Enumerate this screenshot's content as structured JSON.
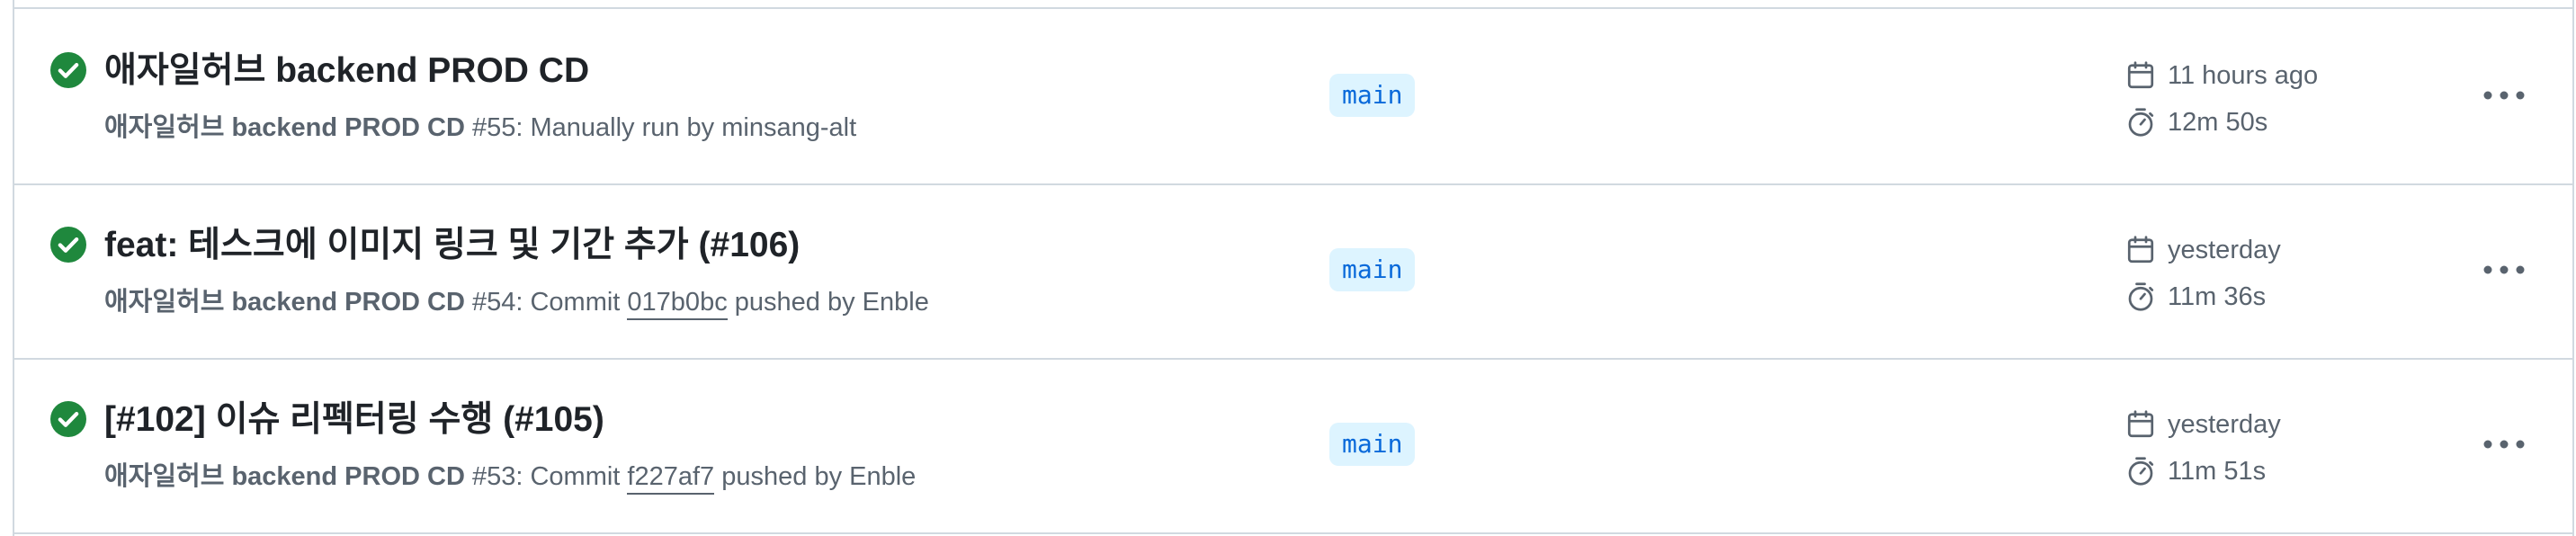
{
  "runs": [
    {
      "title": "애자일허브 backend PROD CD",
      "workflow": "애자일허브 backend PROD CD",
      "run_number": "#55",
      "event_prefix": ": Manually run by minsang-alt",
      "commit_sha": "",
      "event_suffix": "",
      "branch": "main",
      "started": "11 hours ago",
      "duration": "12m 50s",
      "status": "success"
    },
    {
      "title": "feat: 테스크에 이미지 링크 및 기간 추가 (#106)",
      "workflow": "애자일허브 backend PROD CD",
      "run_number": "#54",
      "event_prefix": ": Commit ",
      "commit_sha": "017b0bc",
      "event_suffix": " pushed by Enble",
      "branch": "main",
      "started": "yesterday",
      "duration": "11m 36s",
      "status": "success"
    },
    {
      "title": "[#102] 이슈 리펙터링 수행 (#105)",
      "workflow": "애자일허브 backend PROD CD",
      "run_number": "#53",
      "event_prefix": ": Commit ",
      "commit_sha": "f227af7",
      "event_suffix": " pushed by Enble",
      "branch": "main",
      "started": "yesterday",
      "duration": "11m 51s",
      "status": "success"
    }
  ],
  "icons": {
    "status": "check-circle-fill-icon",
    "started": "calendar-icon",
    "duration": "stopwatch-icon",
    "menu": "kebab-horizontal-icon"
  },
  "colors": {
    "success": "#1f883d",
    "branch_bg": "#ddf4ff",
    "branch_text": "#0969da",
    "muted": "#59636e",
    "border": "#d1d9e0"
  }
}
